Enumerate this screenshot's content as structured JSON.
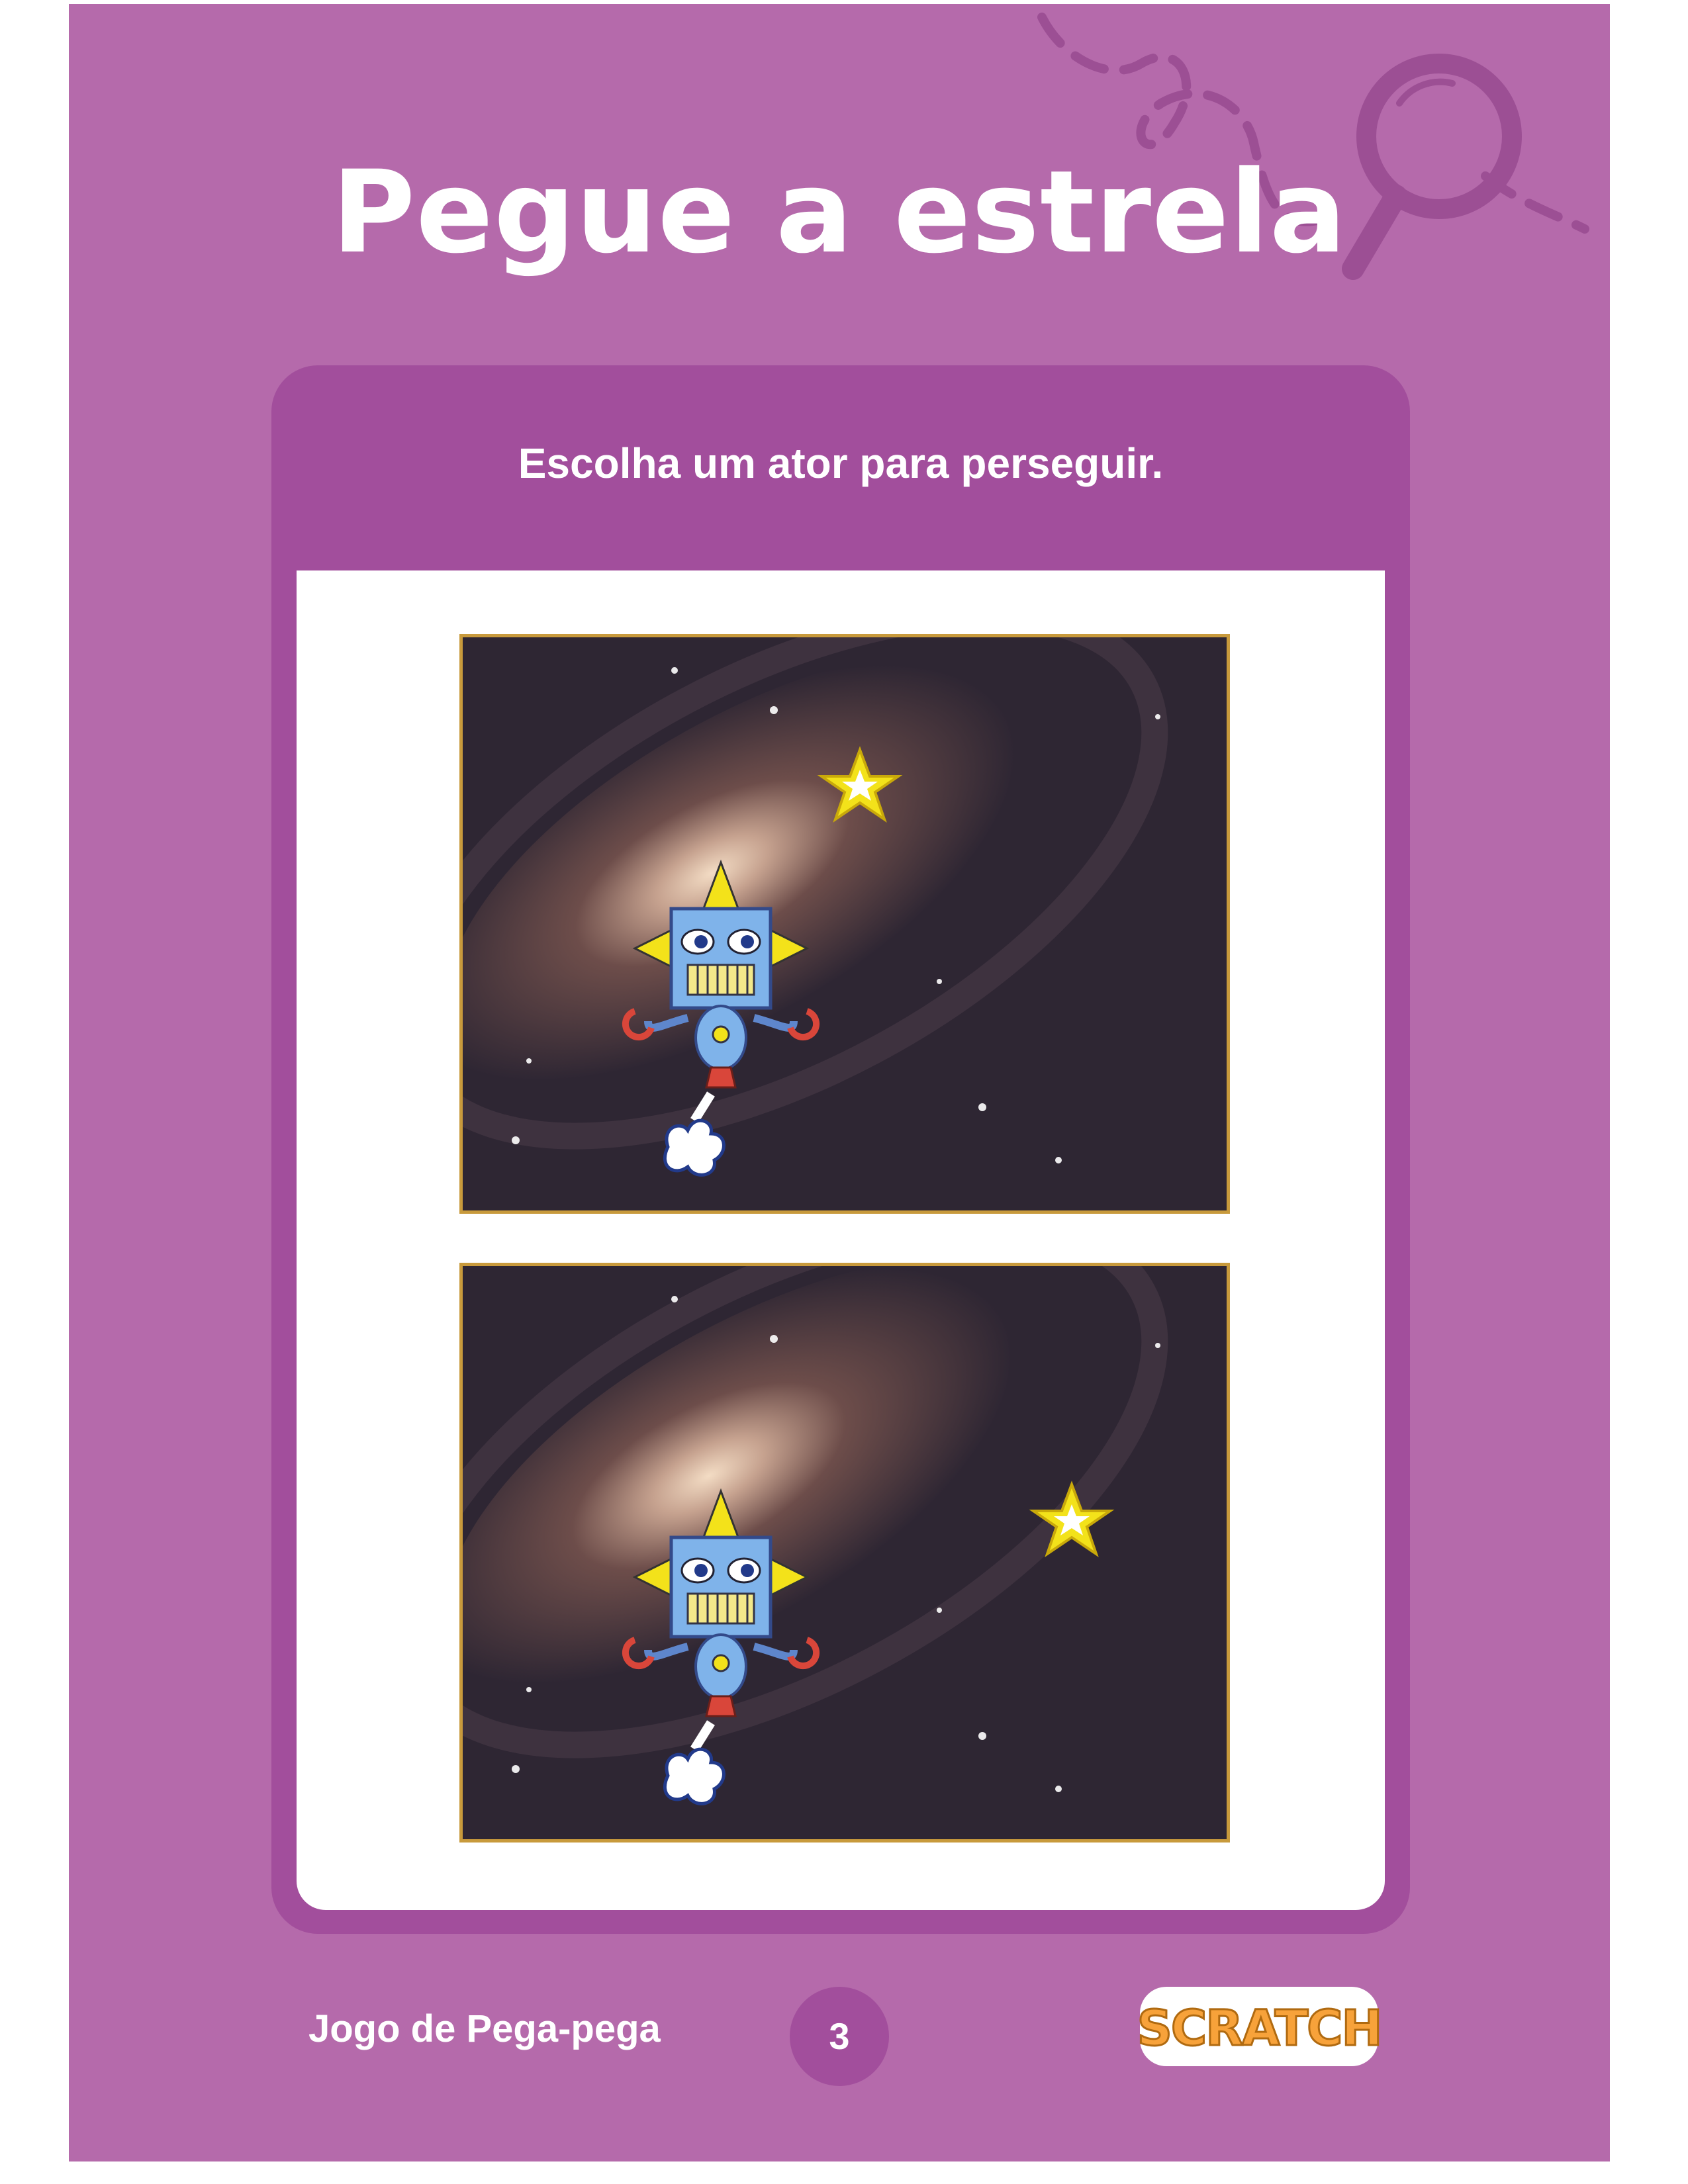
{
  "page": {
    "title": "Pegue a estrela",
    "instruction": "Escolha um ator para perseguir.",
    "footer_label": "Jogo de Pega-pega",
    "page_number": "3",
    "logo_text": "SCRATCH"
  },
  "images": [
    {
      "description_name": "scene-star-top",
      "star_position": "upper-middle"
    },
    {
      "description_name": "scene-star-right",
      "star_position": "right"
    }
  ],
  "colors": {
    "background": "#b56aab",
    "panel": "#a24e9c",
    "frame": "#c89a3c",
    "star": "#f3e21a",
    "robot_body": "#7fb3ea",
    "logo_orange": "#f7a23a"
  }
}
